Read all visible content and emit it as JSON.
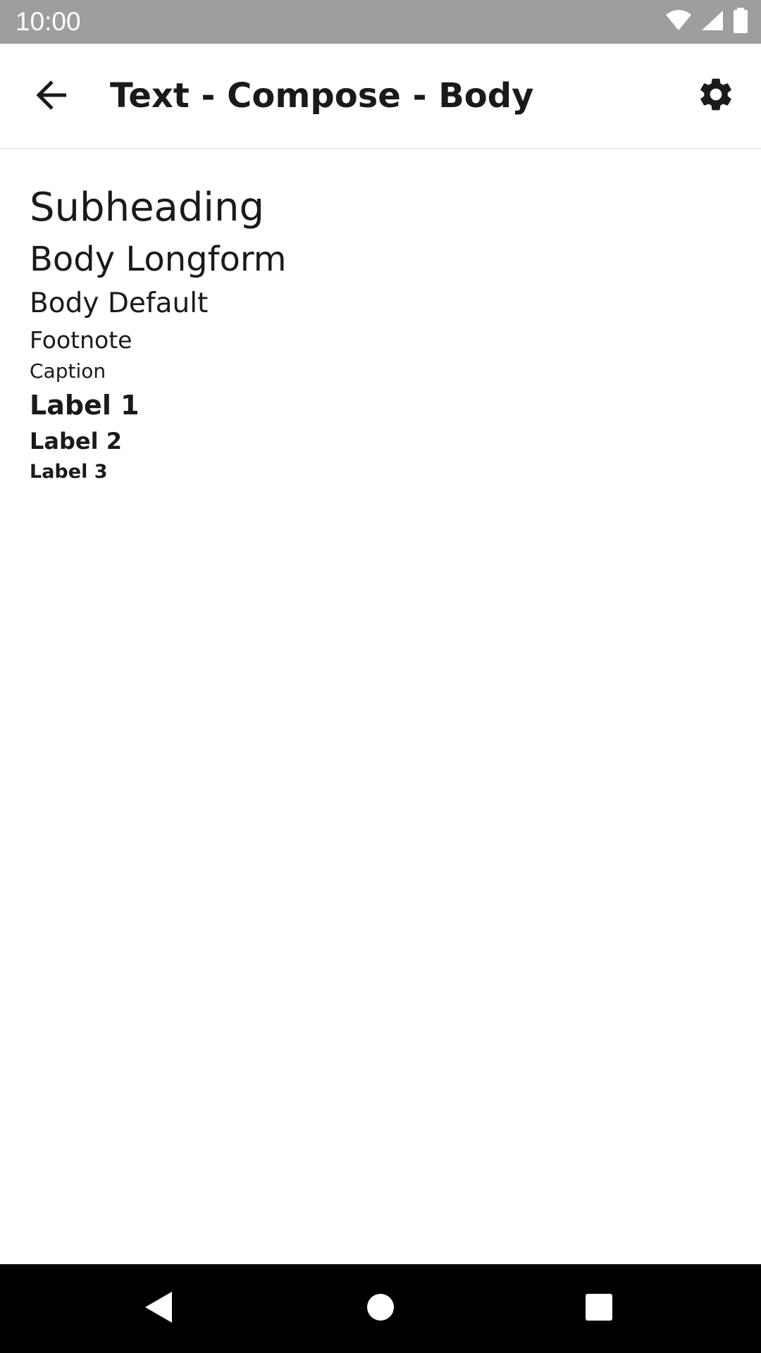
{
  "status_bar": {
    "time": "10:00",
    "background": "#9e9e9e",
    "icons": [
      "wifi-icon",
      "cellular-signal-icon",
      "battery-icon"
    ]
  },
  "app_bar": {
    "title": "Text - Compose - Body",
    "back_icon": "arrow-back-icon",
    "settings_icon": "gear-icon"
  },
  "content": {
    "samples": [
      {
        "label": "Subheading",
        "style": "subheading"
      },
      {
        "label": "Body Longform",
        "style": "body-longform"
      },
      {
        "label": "Body Default",
        "style": "body-default"
      },
      {
        "label": "Footnote",
        "style": "footnote"
      },
      {
        "label": "Caption",
        "style": "caption"
      },
      {
        "label": "Label 1",
        "style": "label-1"
      },
      {
        "label": "Label 2",
        "style": "label-2"
      },
      {
        "label": "Label 3",
        "style": "label-3"
      }
    ]
  },
  "nav_bar": {
    "background": "#000000",
    "buttons": [
      "nav-back-icon",
      "nav-home-icon",
      "nav-recents-icon"
    ]
  }
}
